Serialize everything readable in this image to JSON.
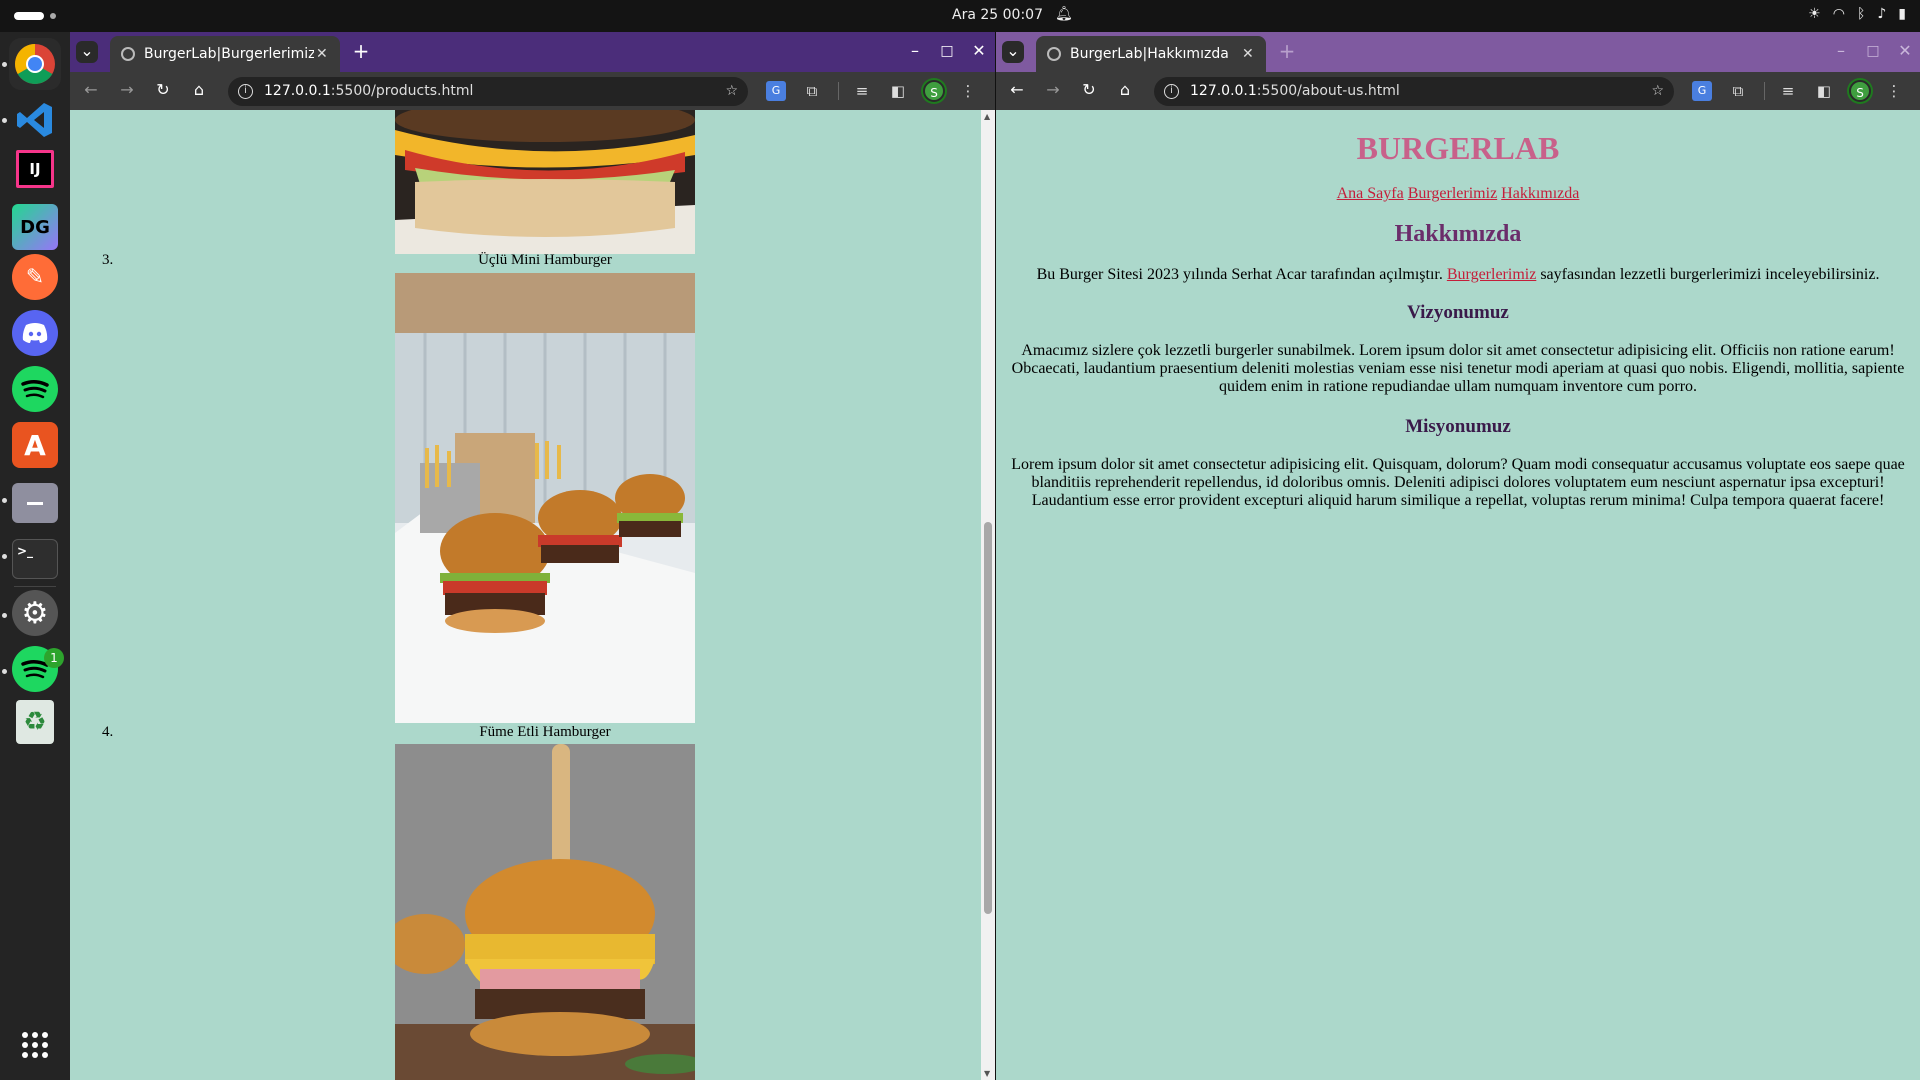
{
  "system": {
    "clock": "Ara 25  00:07"
  },
  "dock": {
    "apps": [
      {
        "name": "chrome-icon",
        "label": ""
      },
      {
        "name": "vscode-icon",
        "label": ""
      },
      {
        "name": "intellij-icon",
        "label": "IJ"
      },
      {
        "name": "datagrip-icon",
        "label": "DG"
      },
      {
        "name": "postman-icon",
        "label": ""
      },
      {
        "name": "discord-icon",
        "label": ""
      },
      {
        "name": "spotify-icon",
        "label": ""
      },
      {
        "name": "app-center-icon",
        "label": "A"
      },
      {
        "name": "files-icon",
        "label": ""
      },
      {
        "name": "terminal-icon",
        "label": ">_"
      },
      {
        "name": "settings-icon",
        "label": ""
      },
      {
        "name": "spotify-2-icon",
        "label": "",
        "badge": "1"
      },
      {
        "name": "trash-icon",
        "label": "♻"
      }
    ]
  },
  "left_window": {
    "tab_title": "BurgerLab|Burgerlerimiz",
    "url_host": "127.0.0.1",
    "url_rest": ":5500/products.html",
    "items": [
      {
        "number": "3.",
        "name": "Üçlü Mini Hamburger"
      },
      {
        "number": "4.",
        "name": "Füme Etli Hamburger"
      }
    ]
  },
  "right_window": {
    "tab_title": "BurgerLab|Hakkımızda",
    "url_host": "127.0.0.1",
    "url_rest": ":5500/about-us.html",
    "site_title": "BURGERLAB",
    "nav": [
      "Ana Sayfa",
      "Burgerlerimiz",
      "Hakkımızda"
    ],
    "heading": "Hakkımızda",
    "intro_before": "Bu Burger Sitesi 2023 yılında Serhat Acar tarafından açılmıştır.",
    "intro_link": "Burgerlerimiz",
    "intro_after": "sayfasından lezzetli burgerlerimizi inceleyebilirsiniz.",
    "vision_title": "Vizyonumuz",
    "vision_text": "Amacımız sizlere çok lezzetli burgerler sunabilmek. Lorem ipsum dolor sit amet consectetur adipisicing elit. Officiis non ratione earum! Obcaecati, laudantium praesentium deleniti molestias veniam esse nisi tenetur modi aperiam at quasi quo nobis. Eligendi, mollitia, sapiente quidem enim in ratione repudiandae ullam numquam inventore cum porro.",
    "mission_title": "Misyonumuz",
    "mission_text": "Lorem ipsum dolor sit amet consectetur adipisicing elit. Quisquam, dolorum? Quam modi consequatur accusamus voluptate eos saepe quae blanditiis reprehenderit repellendus, id doloribus omnis. Deleniti adipisci dolores voluptatem eum nesciunt aspernatur ipsa excepturi! Laudantium esse error provident excepturi aliquid harum similique a repellat, voluptas rerum minima! Culpa tempora quaerat facere!"
  },
  "colors": {
    "page_bg": "#acd8cb",
    "title_color": "#c8618a",
    "heading_color": "#6b2d6b",
    "subheading_color": "#3a1a4a",
    "link_color": "#c41e3a",
    "tabbar_left": "#4b2d7a",
    "tabbar_right": "#7f5aa0"
  }
}
